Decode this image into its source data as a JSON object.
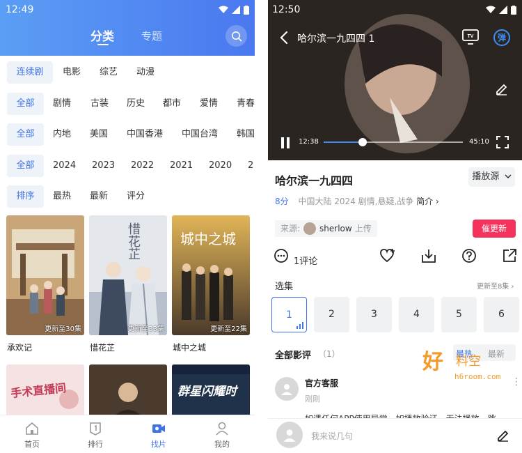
{
  "left": {
    "status": {
      "time": "12:49"
    },
    "top_tabs": {
      "active": "分类",
      "other": "专题"
    },
    "rows": [
      {
        "items": [
          "连续剧",
          "电影",
          "综艺",
          "动漫"
        ]
      },
      {
        "items": [
          "全部",
          "剧情",
          "古装",
          "历史",
          "都市",
          "爱情",
          "青春"
        ]
      },
      {
        "items": [
          "全部",
          "内地",
          "美国",
          "中国香港",
          "中国台湾",
          "韩国"
        ]
      },
      {
        "items": [
          "全部",
          "2024",
          "2023",
          "2022",
          "2021",
          "2020",
          "2"
        ]
      },
      {
        "items": [
          "排序",
          "最热",
          "最新",
          "评分"
        ]
      }
    ],
    "posters": [
      {
        "title": "承欢记",
        "badge": "更新至30集",
        "color_a": "#8c6a4a",
        "color_b": "#c9a678"
      },
      {
        "title": "惜花芷",
        "badge": "更新至33集",
        "color_a": "#d8dde3",
        "color_b": "#8a96a6",
        "poster_text": "惜花芷"
      },
      {
        "title": "城中之城",
        "badge": "更新至22集",
        "color_a": "#c79a42",
        "color_b": "#3a2f26",
        "poster_text": "城中之城"
      },
      {
        "title": "",
        "badge": "",
        "color_a": "#e8c8c9",
        "color_b": "#f7e9ea",
        "poster_text": "手术直播间"
      },
      {
        "title": "",
        "badge": "",
        "color_a": "#5b4a3a",
        "color_b": "#2f2620"
      },
      {
        "title": "",
        "badge": "",
        "color_a": "#1d2c3f",
        "color_b": "#3c5b78",
        "poster_text": "群星闪耀时"
      }
    ],
    "nav": [
      {
        "label": "首页",
        "icon": "home-icon",
        "active": false
      },
      {
        "label": "排行",
        "icon": "ranking-icon",
        "active": false
      },
      {
        "label": "找片",
        "icon": "video-camera-icon",
        "active": true
      },
      {
        "label": "我的",
        "icon": "user-icon",
        "active": false
      }
    ]
  },
  "right": {
    "status": {
      "time": "12:50"
    },
    "player": {
      "title": "哈尔滨一九四四 1",
      "danmaku": "弹",
      "current_time": "12:38",
      "duration": "45:10",
      "progress": 0.28
    },
    "detail": {
      "title": "哈尔滨一九四四",
      "source_button": "播放源",
      "score": "8分",
      "meta": "中国大陆  2024  剧情,悬疑,战争",
      "intro": "简介",
      "from_label": "来源:",
      "uploader": "sherlow",
      "upload_suffix": "上传",
      "urge_button": "催更新"
    },
    "actions": {
      "comment": "1评论"
    },
    "episodes": {
      "heading": "选集",
      "more": "更新至8集",
      "list": [
        "1",
        "2",
        "3",
        "4",
        "5",
        "6"
      ],
      "selected": "1"
    },
    "reviews": {
      "heading": "全部影评",
      "count": "（1）",
      "sort_hot": "最热",
      "sort_new": "最新",
      "comment": {
        "name": "官方客服",
        "time": "刚刚",
        "body": "如遇任何APP使用异常，如播放验证、无法播放、跳"
      }
    },
    "input": {
      "placeholder": "我来说几句"
    },
    "watermark": {
      "big": "好",
      "small": "料空",
      "url": "h6room.com"
    }
  },
  "colors": {
    "accent": "#3f73e6",
    "urge": "#f5325c",
    "header_a": "#5b9ef5",
    "header_b": "#4a78ef"
  }
}
